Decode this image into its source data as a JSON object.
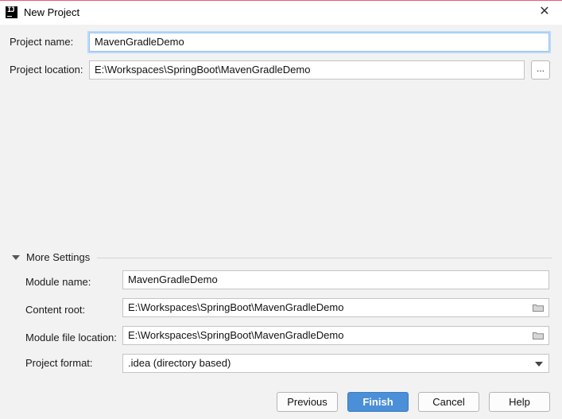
{
  "window": {
    "title": "New Project",
    "accent_color": "#e85a7a",
    "app_icon_letters": "IJ"
  },
  "project": {
    "name_label": "Project name:",
    "name_value": "MavenGradleDemo",
    "location_label": "Project location:",
    "location_value": "E:\\Workspaces\\SpringBoot\\MavenGradleDemo",
    "browse_label": "..."
  },
  "more_settings": {
    "title": "More Settings",
    "expanded": true,
    "module_name_label": "Module name:",
    "module_name_value": "MavenGradleDemo",
    "content_root_label": "Content root:",
    "content_root_value": "E:\\Workspaces\\SpringBoot\\MavenGradleDemo",
    "module_file_label": "Module file location:",
    "module_file_value": "E:\\Workspaces\\SpringBoot\\MavenGradleDemo",
    "project_format_label": "Project format:",
    "project_format_value": ".idea (directory based)"
  },
  "buttons": {
    "previous": "Previous",
    "finish": "Finish",
    "cancel": "Cancel",
    "help": "Help"
  },
  "icons": {
    "app": "intellij-icon",
    "close": "close-icon",
    "folder": "folder-icon",
    "expand": "triangle-down-icon",
    "dropdown": "chevron-down-icon"
  }
}
